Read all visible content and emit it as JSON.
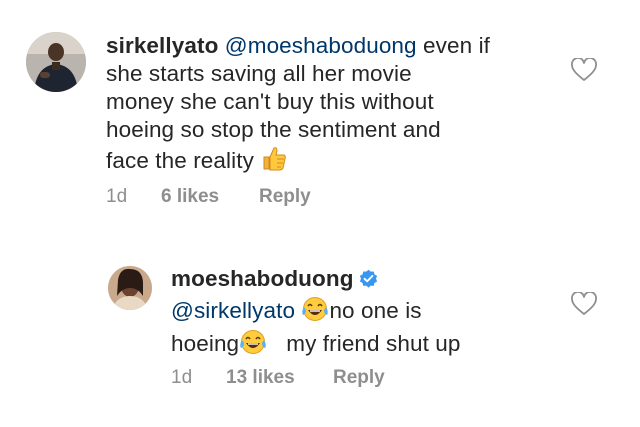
{
  "comments": [
    {
      "username": "sirkellyato",
      "mention": "@moeshaboduong",
      "text_lines": [
        " even if",
        "she starts saving all her movie",
        "money she can't buy this without",
        "hoeing so stop the sentiment and",
        "face the reality "
      ],
      "emoji": "thumbs-up",
      "time": "1d",
      "likes": "6 likes",
      "reply_label": "Reply"
    },
    {
      "username": "moeshaboduong",
      "verified": true,
      "mention": "@sirkellyato",
      "text_line1_after_emoji": "no one is",
      "text_line2_before_emoji": "hoeing",
      "text_line2_after_emoji": "my friend shut up",
      "emoji": "face-with-tears-of-joy",
      "time": "1d",
      "likes": "13 likes",
      "reply_label": "Reply"
    }
  ],
  "icons": {
    "like": "heart-outline-icon",
    "verified": "verified-badge-icon"
  },
  "colors": {
    "text": "#262626",
    "mention": "#00376b",
    "meta": "#8e8e8e",
    "verified": "#3897f0"
  }
}
